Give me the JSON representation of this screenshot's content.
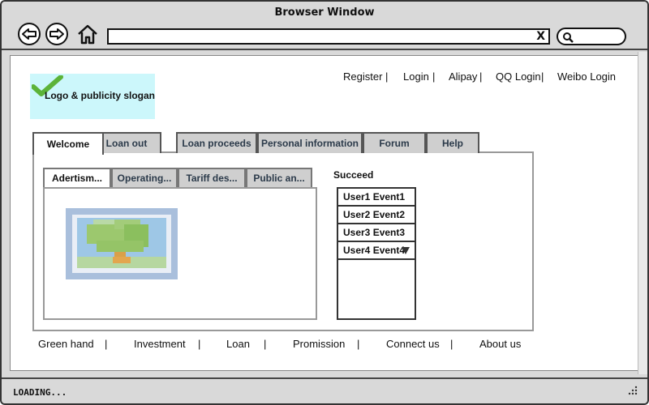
{
  "window": {
    "title": "Browser Window",
    "url_clear": "X",
    "status": "LOADING..."
  },
  "logo": {
    "text": "Logo & publicity slogan"
  },
  "top_links": [
    {
      "label": "Register"
    },
    {
      "label": "Login"
    },
    {
      "label": "Alipay"
    },
    {
      "label": "QQ Login"
    },
    {
      "label": "Weibo Login"
    }
  ],
  "separator": "|",
  "tabs": [
    {
      "label": "Welcome",
      "active": true
    },
    {
      "label": "Loan out"
    },
    {
      "label": "Loan proceeds"
    },
    {
      "label": "Personal information"
    },
    {
      "label": "Forum"
    },
    {
      "label": "Help"
    }
  ],
  "subtabs": [
    {
      "label": "Adertism...",
      "active": true
    },
    {
      "label": "Operating..."
    },
    {
      "label": "Tariff des..."
    },
    {
      "label": "Public an..."
    }
  ],
  "succeed": {
    "label": "Succeed",
    "items": [
      "User1 Event1",
      "User2 Event2",
      "User3 Event3",
      "User4 Event4"
    ]
  },
  "footer_links": [
    {
      "label": "Green hand"
    },
    {
      "label": "Investment"
    },
    {
      "label": "Loan"
    },
    {
      "label": "Promission"
    },
    {
      "label": "Connect us"
    },
    {
      "label": "About us"
    }
  ],
  "colors": {
    "logo_bg": "#ccf7fb",
    "tab_inactive": "#cfcfcf",
    "check": "#5cb338"
  },
  "icons": {
    "back": "arrow-left-icon",
    "forward": "arrow-right-icon",
    "home": "home-icon",
    "search": "search-icon",
    "check": "checkmark-icon",
    "dropdown": "triangle-down-icon",
    "grip": "resize-grip-icon",
    "image": "image-placeholder-icon"
  }
}
